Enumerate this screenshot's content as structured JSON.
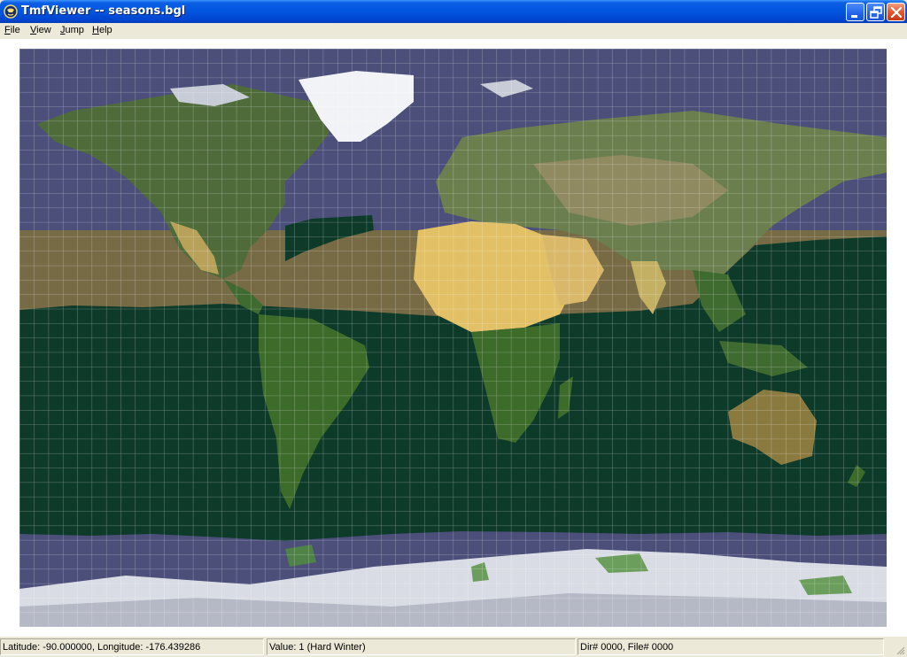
{
  "window": {
    "title": "TmfViewer -- seasons.bgl",
    "icon": "app-globe-icon",
    "buttons": [
      "minimize-icon",
      "maximize-icon",
      "close-icon"
    ]
  },
  "menu": [
    {
      "key": "F",
      "rest": "ile"
    },
    {
      "key": "V",
      "rest": "iew"
    },
    {
      "key": "J",
      "rest": "ump"
    },
    {
      "key": "H",
      "rest": "elp"
    }
  ],
  "colors": {
    "ocean": "#4b4f7a",
    "hard_winter": "#0e3a2a",
    "dry_season": "#8a7a40",
    "grid": "#ffffff",
    "desert": "#e6c565",
    "ice": "#d8d8e2"
  },
  "status": {
    "position": "Latitude: -90.000000, Longitude: -176.439286",
    "value": "Value: 1 (Hard Winter)",
    "file": "Dir# 0000, File# 0000"
  }
}
